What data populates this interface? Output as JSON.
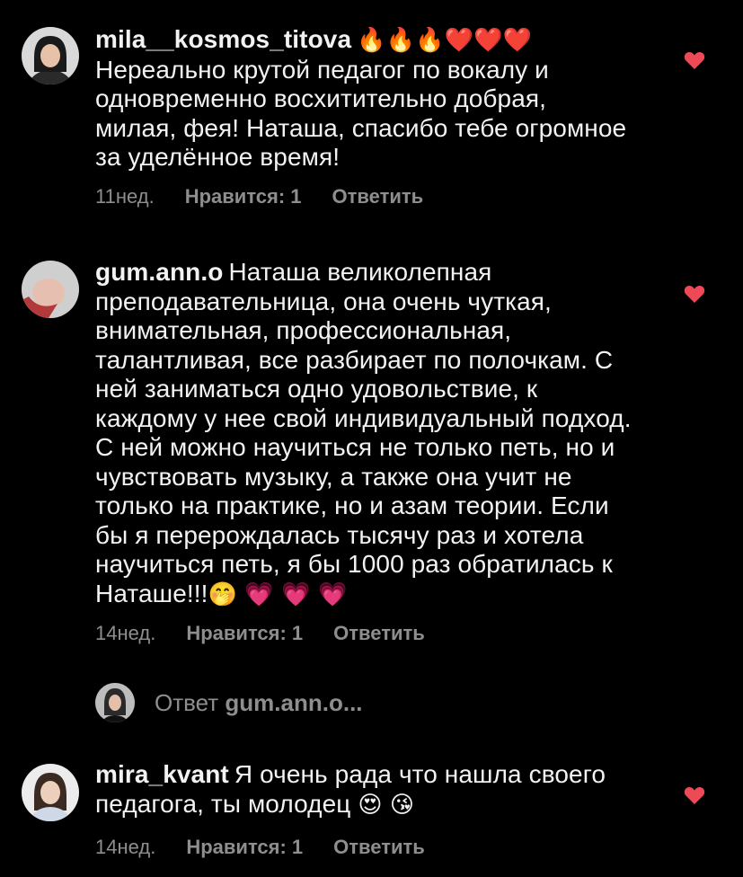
{
  "comments": [
    {
      "username": "mila__kosmos_titova",
      "emoji_prefix": "🔥🔥🔥❤️❤️❤️",
      "text": "Нереально крутой педагог по вокалу и одновременно восхитительно добрая, милая,  фея! Наташа, спасибо тебе огромное за уделённое время!",
      "time": "11нед.",
      "likes": "Нравится: 1",
      "reply": "Ответить",
      "heart_icon": "heart-icon"
    },
    {
      "username": "gum.ann.o",
      "text": "Наташа великолепная преподавательница, она очень чуткая, внимательная, профессиональная, талантливая, все разбирает по полочкам. С ней заниматься одно удовольствие, к каждому у нее свой индивидуальный подход. С ней можно научиться не только петь, но и чувствовать музыку, а также она учит не только на практике, но и азам теории. Если бы я перерождалась тысячу раз и хотела научиться петь, я бы 1000 раз обратилась к Наташе!!!",
      "emoji_suffix": "🤭 💗 💗 💗",
      "time": "14нед.",
      "likes": "Нравится: 1",
      "reply": "Ответить",
      "heart_icon": "heart-icon"
    },
    {
      "username": "mira_kvant",
      "text": "Я очень рада что нашла своего педагога, ты молодец",
      "emoji_suffix": "😍 😘",
      "time": "14нед.",
      "likes": "Нравится: 1",
      "reply": "Ответить",
      "heart_icon": "heart-icon"
    }
  ],
  "reply_thread": {
    "prefix": "Ответ",
    "username": "gum.ann.o..."
  },
  "colors": {
    "background": "#000000",
    "text": "#f2f2f2",
    "muted": "#8e8e8e",
    "heart": "#ed4956"
  }
}
